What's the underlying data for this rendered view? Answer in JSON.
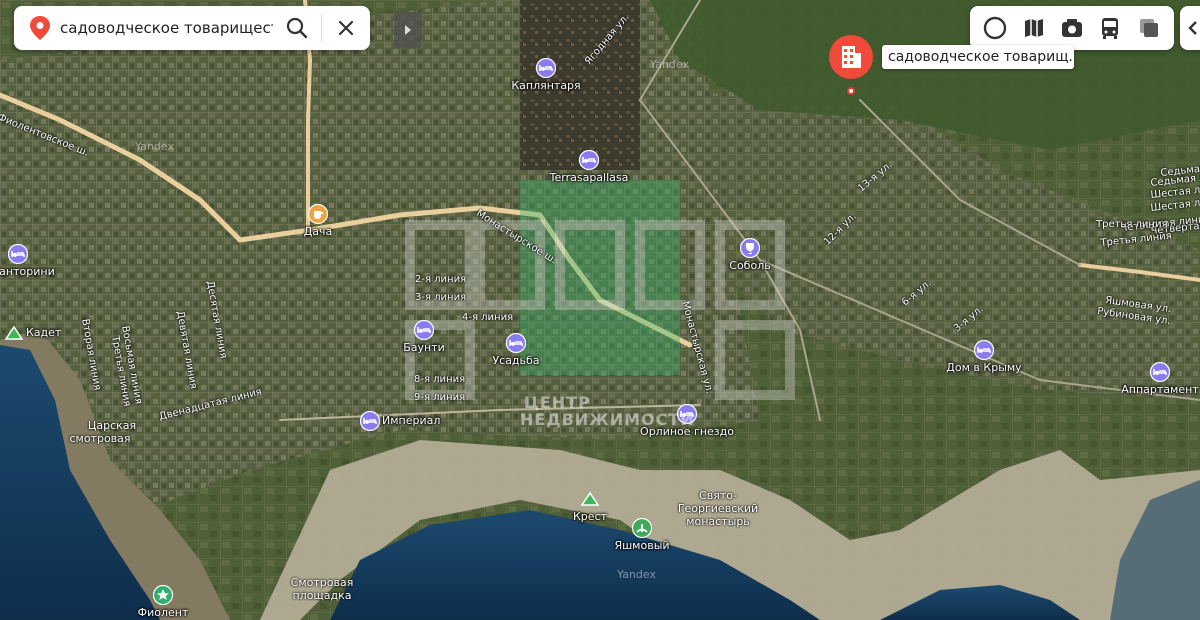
{
  "search": {
    "query": "садоводческое товарищество Н"
  },
  "selected_place": {
    "label": "садоводческое товарищ..."
  },
  "colors": {
    "accent": "#f04a3a",
    "poi": "#8a7cf0",
    "cafe": "#f0a341",
    "sea": "#123a5c",
    "land": "#4b5b3e",
    "road": "#e9cf9b"
  },
  "pois": [
    {
      "name": "Каплянтаря",
      "icon": "bed-icon"
    },
    {
      "name": "Terrasapallasa",
      "icon": "bed-icon"
    },
    {
      "name": "Дача",
      "icon": "cafe-icon"
    },
    {
      "name": "а Санторини",
      "icon": "bed-icon"
    },
    {
      "name": "Кадет",
      "icon": "peak-icon"
    },
    {
      "name": "Соболь",
      "icon": "trophy-icon"
    },
    {
      "name": "Баунти",
      "icon": "bed-icon"
    },
    {
      "name": "Усадьба",
      "icon": "bed-icon"
    },
    {
      "name": "Империал",
      "icon": "bed-icon"
    },
    {
      "name": "Орлиное гнездо",
      "icon": "bed-icon"
    },
    {
      "name": "Дом в Крыму",
      "icon": "bed-icon"
    },
    {
      "name": "Аппартамент",
      "icon": "bed-icon"
    },
    {
      "name": "Крест",
      "icon": "peak-icon"
    },
    {
      "name": "Яшмовый",
      "icon": "beach-icon"
    },
    {
      "name": "Фиолент",
      "icon": "star-icon"
    }
  ],
  "place_labels": [
    {
      "text": "Царская"
    },
    {
      "text": "смотровая"
    },
    {
      "text": "Свято-"
    },
    {
      "text": "Георгиевский"
    },
    {
      "text": "монастырь"
    },
    {
      "text": "Смотровая"
    },
    {
      "text": "площадка"
    }
  ],
  "street_labels": [
    {
      "text": "Монастырское ш."
    },
    {
      "text": "Фиолентовское ш."
    },
    {
      "text": "Рубиновая ул."
    },
    {
      "text": "Яшмовая ул."
    },
    {
      "text": "Четвертая линия"
    },
    {
      "text": "Третья линия"
    },
    {
      "text": "Шестая линия"
    },
    {
      "text": "Седьмая линия"
    },
    {
      "text": "Двенадцатая линия"
    },
    {
      "text": "Десятая линия"
    },
    {
      "text": "Девятая линия"
    },
    {
      "text": "Восьмая линия"
    },
    {
      "text": "Вторая линия"
    },
    {
      "text": "Третья линия"
    },
    {
      "text": "2-я линия"
    },
    {
      "text": "3-я линия"
    },
    {
      "text": "4-я линия"
    },
    {
      "text": "8-я линия"
    },
    {
      "text": "9-я линия"
    },
    {
      "text": "12-я ул."
    },
    {
      "text": "13-я ул."
    },
    {
      "text": "6-я ул."
    },
    {
      "text": "3-я ул."
    },
    {
      "text": "Ягодная ул."
    },
    {
      "text": "Монастырская ул."
    },
    {
      "text": "Четвертая линия"
    },
    {
      "text": "Шестая линия"
    },
    {
      "text": "Седьмая линия"
    },
    {
      "text": "Третья линия"
    }
  ],
  "watermark": {
    "line1": "ЦЕНТР",
    "line2": "НЕДВИЖИМОСТИ"
  },
  "yandex": {
    "label": "Yandex"
  }
}
